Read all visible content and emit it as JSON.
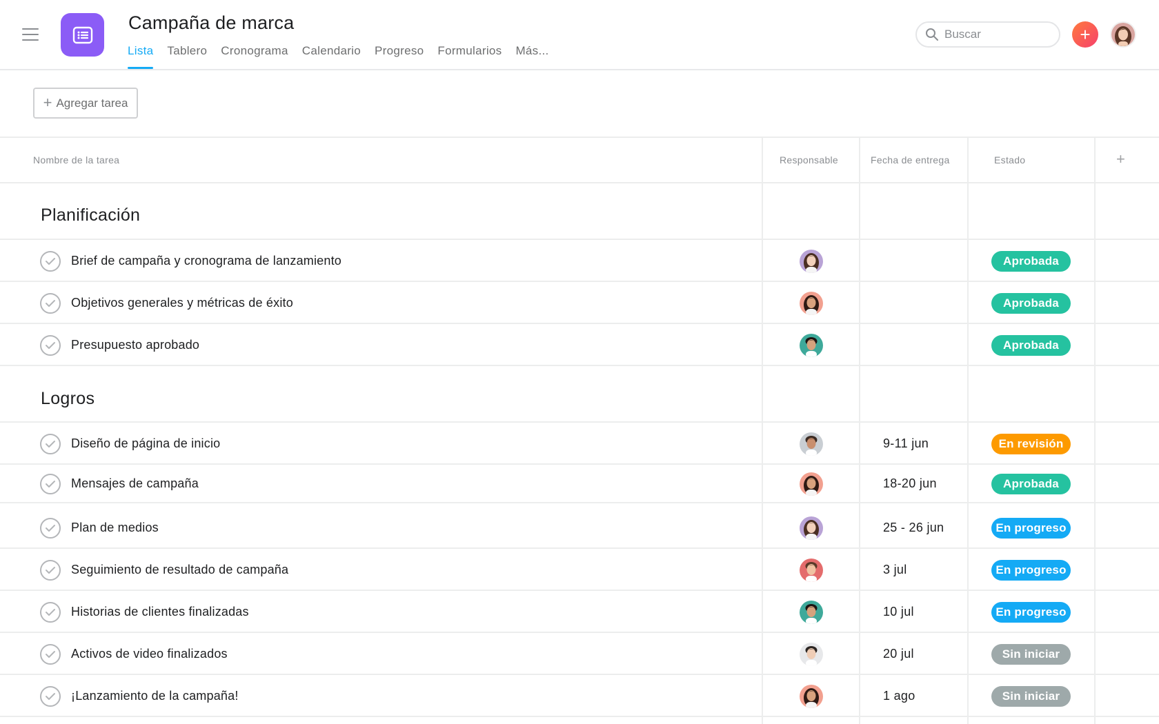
{
  "header": {
    "title": "Campaña de marca",
    "tabs": [
      "Lista",
      "Tablero",
      "Cronograma",
      "Calendario",
      "Progreso",
      "Formularios",
      "Más..."
    ],
    "active_tab": "Lista",
    "search_placeholder": "Buscar",
    "add_symbol": "+"
  },
  "toolbar": {
    "add_task_label": "Agregar tarea"
  },
  "columns": {
    "name": "Nombre de la tarea",
    "assignee": "Responsable",
    "due": "Fecha de entrega",
    "status": "Estado",
    "add": "+"
  },
  "colors": {
    "accent": "#14aaf5",
    "project_icon": "#8b5cf6",
    "Aprobada": "#25c2a0",
    "En revisión": "#fd9a00",
    "En progreso": "#14aaf5",
    "Sin iniciar": "#9ea9aa"
  },
  "sections": [
    {
      "title": "Planificación",
      "tasks": [
        {
          "name": "Brief de campaña y cronograma de lanzamiento",
          "due": "",
          "status": "Aprobada",
          "avatar": "avatar-woman-purple"
        },
        {
          "name": "Objetivos generales y métricas de éxito",
          "due": "",
          "status": "Aprobada",
          "avatar": "avatar-woman-coral"
        },
        {
          "name": "Presupuesto aprobado",
          "due": "",
          "status": "Aprobada",
          "avatar": "avatar-man-teal"
        }
      ]
    },
    {
      "title": "Logros",
      "tasks": [
        {
          "name": "Diseño de página de inicio",
          "due": "9-11 jun",
          "status": "En revisión",
          "avatar": "avatar-man-gray"
        },
        {
          "name": "Mensajes de campaña",
          "due": "18-20 jun",
          "status": "Aprobada",
          "avatar": "avatar-woman-coral"
        },
        {
          "name": "Plan de medios",
          "due": "25 - 26 jun",
          "status": "En progreso",
          "avatar": "avatar-woman-purple"
        },
        {
          "name": "Seguimiento de resultado de campaña",
          "due": "3 jul",
          "status": "En progreso",
          "avatar": "avatar-man-red"
        },
        {
          "name": "Historias de clientes finalizadas",
          "due": "10 jul",
          "status": "En progreso",
          "avatar": "avatar-man-teal"
        },
        {
          "name": "Activos de video finalizados",
          "due": "20 jul",
          "status": "Sin iniciar",
          "avatar": "avatar-man-light"
        },
        {
          "name": "¡Lanzamiento de la campaña!",
          "due": "1 ago",
          "status": "Sin iniciar",
          "avatar": "avatar-woman-coral"
        }
      ]
    }
  ]
}
